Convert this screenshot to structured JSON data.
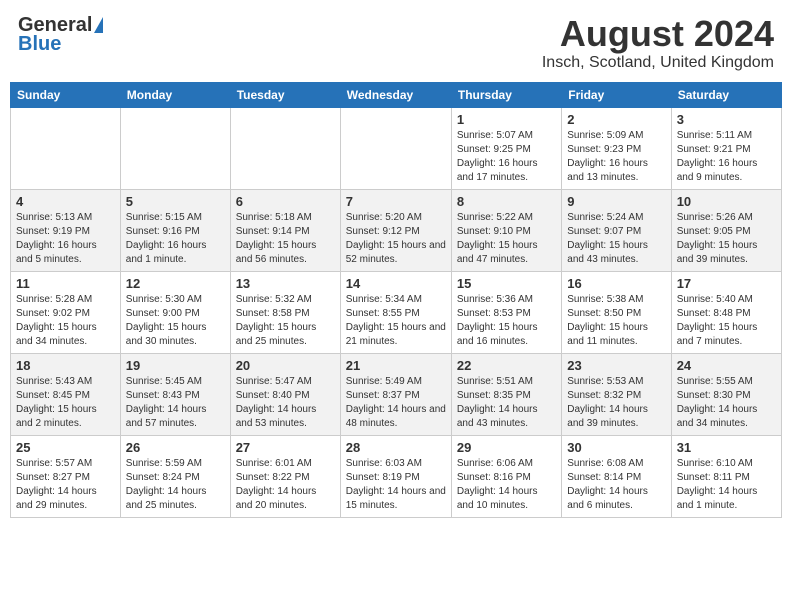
{
  "header": {
    "logo_general": "General",
    "logo_blue": "Blue",
    "title": "August 2024",
    "location": "Insch, Scotland, United Kingdom"
  },
  "days_of_week": [
    "Sunday",
    "Monday",
    "Tuesday",
    "Wednesday",
    "Thursday",
    "Friday",
    "Saturday"
  ],
  "weeks": [
    [
      {
        "num": "",
        "info": ""
      },
      {
        "num": "",
        "info": ""
      },
      {
        "num": "",
        "info": ""
      },
      {
        "num": "",
        "info": ""
      },
      {
        "num": "1",
        "info": "Sunrise: 5:07 AM\nSunset: 9:25 PM\nDaylight: 16 hours\nand 17 minutes."
      },
      {
        "num": "2",
        "info": "Sunrise: 5:09 AM\nSunset: 9:23 PM\nDaylight: 16 hours\nand 13 minutes."
      },
      {
        "num": "3",
        "info": "Sunrise: 5:11 AM\nSunset: 9:21 PM\nDaylight: 16 hours\nand 9 minutes."
      }
    ],
    [
      {
        "num": "4",
        "info": "Sunrise: 5:13 AM\nSunset: 9:19 PM\nDaylight: 16 hours\nand 5 minutes."
      },
      {
        "num": "5",
        "info": "Sunrise: 5:15 AM\nSunset: 9:16 PM\nDaylight: 16 hours\nand 1 minute."
      },
      {
        "num": "6",
        "info": "Sunrise: 5:18 AM\nSunset: 9:14 PM\nDaylight: 15 hours\nand 56 minutes."
      },
      {
        "num": "7",
        "info": "Sunrise: 5:20 AM\nSunset: 9:12 PM\nDaylight: 15 hours\nand 52 minutes."
      },
      {
        "num": "8",
        "info": "Sunrise: 5:22 AM\nSunset: 9:10 PM\nDaylight: 15 hours\nand 47 minutes."
      },
      {
        "num": "9",
        "info": "Sunrise: 5:24 AM\nSunset: 9:07 PM\nDaylight: 15 hours\nand 43 minutes."
      },
      {
        "num": "10",
        "info": "Sunrise: 5:26 AM\nSunset: 9:05 PM\nDaylight: 15 hours\nand 39 minutes."
      }
    ],
    [
      {
        "num": "11",
        "info": "Sunrise: 5:28 AM\nSunset: 9:02 PM\nDaylight: 15 hours\nand 34 minutes."
      },
      {
        "num": "12",
        "info": "Sunrise: 5:30 AM\nSunset: 9:00 PM\nDaylight: 15 hours\nand 30 minutes."
      },
      {
        "num": "13",
        "info": "Sunrise: 5:32 AM\nSunset: 8:58 PM\nDaylight: 15 hours\nand 25 minutes."
      },
      {
        "num": "14",
        "info": "Sunrise: 5:34 AM\nSunset: 8:55 PM\nDaylight: 15 hours\nand 21 minutes."
      },
      {
        "num": "15",
        "info": "Sunrise: 5:36 AM\nSunset: 8:53 PM\nDaylight: 15 hours\nand 16 minutes."
      },
      {
        "num": "16",
        "info": "Sunrise: 5:38 AM\nSunset: 8:50 PM\nDaylight: 15 hours\nand 11 minutes."
      },
      {
        "num": "17",
        "info": "Sunrise: 5:40 AM\nSunset: 8:48 PM\nDaylight: 15 hours\nand 7 minutes."
      }
    ],
    [
      {
        "num": "18",
        "info": "Sunrise: 5:43 AM\nSunset: 8:45 PM\nDaylight: 15 hours\nand 2 minutes."
      },
      {
        "num": "19",
        "info": "Sunrise: 5:45 AM\nSunset: 8:43 PM\nDaylight: 14 hours\nand 57 minutes."
      },
      {
        "num": "20",
        "info": "Sunrise: 5:47 AM\nSunset: 8:40 PM\nDaylight: 14 hours\nand 53 minutes."
      },
      {
        "num": "21",
        "info": "Sunrise: 5:49 AM\nSunset: 8:37 PM\nDaylight: 14 hours\nand 48 minutes."
      },
      {
        "num": "22",
        "info": "Sunrise: 5:51 AM\nSunset: 8:35 PM\nDaylight: 14 hours\nand 43 minutes."
      },
      {
        "num": "23",
        "info": "Sunrise: 5:53 AM\nSunset: 8:32 PM\nDaylight: 14 hours\nand 39 minutes."
      },
      {
        "num": "24",
        "info": "Sunrise: 5:55 AM\nSunset: 8:30 PM\nDaylight: 14 hours\nand 34 minutes."
      }
    ],
    [
      {
        "num": "25",
        "info": "Sunrise: 5:57 AM\nSunset: 8:27 PM\nDaylight: 14 hours\nand 29 minutes."
      },
      {
        "num": "26",
        "info": "Sunrise: 5:59 AM\nSunset: 8:24 PM\nDaylight: 14 hours\nand 25 minutes."
      },
      {
        "num": "27",
        "info": "Sunrise: 6:01 AM\nSunset: 8:22 PM\nDaylight: 14 hours\nand 20 minutes."
      },
      {
        "num": "28",
        "info": "Sunrise: 6:03 AM\nSunset: 8:19 PM\nDaylight: 14 hours\nand 15 minutes."
      },
      {
        "num": "29",
        "info": "Sunrise: 6:06 AM\nSunset: 8:16 PM\nDaylight: 14 hours\nand 10 minutes."
      },
      {
        "num": "30",
        "info": "Sunrise: 6:08 AM\nSunset: 8:14 PM\nDaylight: 14 hours\nand 6 minutes."
      },
      {
        "num": "31",
        "info": "Sunrise: 6:10 AM\nSunset: 8:11 PM\nDaylight: 14 hours\nand 1 minute."
      }
    ]
  ]
}
